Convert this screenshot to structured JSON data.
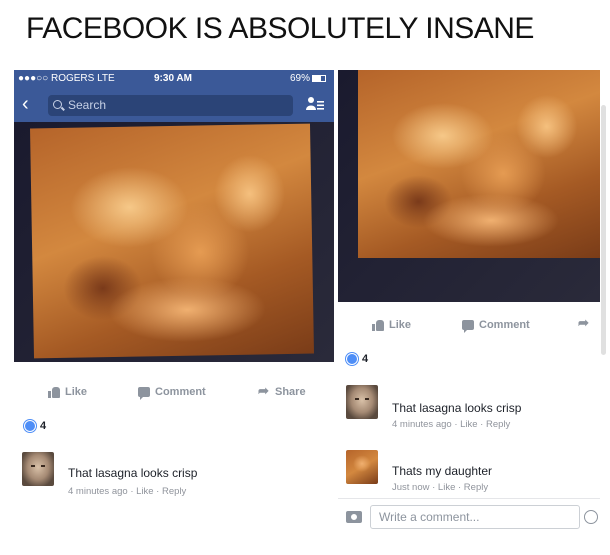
{
  "meme": {
    "title": "FACEBOOK IS ABSOLUTELY INSANE"
  },
  "left": {
    "status": {
      "carrier": "●●●○○ ROGERS  LTE",
      "time": "9:30 AM",
      "battery": "69%"
    },
    "search": {
      "placeholder": "Search"
    },
    "actions": {
      "like": "Like",
      "comment": "Comment",
      "share": "Share"
    },
    "reactions": {
      "count": "4"
    },
    "comment": {
      "text": "That lasagna looks crisp",
      "meta": "4 minutes ago · Like · Reply"
    }
  },
  "right": {
    "actions": {
      "like": "Like",
      "comment": "Comment"
    },
    "reactions": {
      "count": "4"
    },
    "comments": [
      {
        "text": "That lasagna looks crisp",
        "meta": "4 minutes ago · Like · Reply"
      },
      {
        "text": "Thats my daughter",
        "meta": "Just now · Like · Reply"
      }
    ],
    "write": {
      "placeholder": "Write a comment..."
    }
  },
  "colors": {
    "facebook_blue": "#3b5998",
    "meta_gray": "#90949c",
    "action_gray": "#8d949e"
  },
  "icons": [
    "back-icon",
    "search-icon",
    "friends-icon",
    "like-icon",
    "comment-icon",
    "share-icon",
    "reaction-icon",
    "camera-icon",
    "smiley-icon"
  ]
}
